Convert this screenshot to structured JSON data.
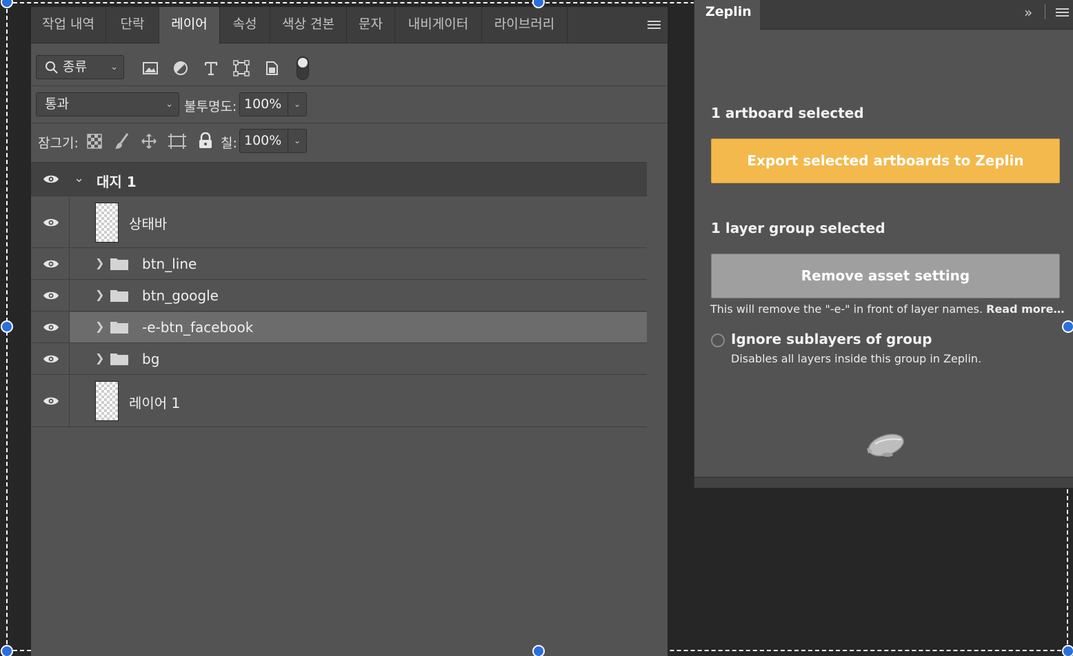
{
  "layers_panel": {
    "tabs": [
      {
        "label": "작업 내역"
      },
      {
        "label": "단락"
      },
      {
        "label": "레이어"
      },
      {
        "label": "속성"
      },
      {
        "label": "색상 견본"
      },
      {
        "label": "문자"
      },
      {
        "label": "내비게이터"
      },
      {
        "label": "라이브러리"
      }
    ],
    "active_tab": "레이어",
    "filter": {
      "kind_label": "종류"
    },
    "blend_mode": "통과",
    "opacity_label": "불투명도:",
    "opacity_value": "100%",
    "lock_label": "잠그기:",
    "fill_label": "칠:",
    "fill_value": "100%",
    "layers": [
      {
        "name": "대지 1",
        "type": "artboard",
        "expanded": true
      },
      {
        "name": "상태바",
        "type": "layer"
      },
      {
        "name": "btn_line",
        "type": "group",
        "expanded": false
      },
      {
        "name": "btn_google",
        "type": "group",
        "expanded": false
      },
      {
        "name": "-e-btn_facebook",
        "type": "group",
        "expanded": false,
        "selected": true
      },
      {
        "name": "bg",
        "type": "group",
        "expanded": false
      },
      {
        "name": "레이어 1",
        "type": "layer"
      }
    ]
  },
  "zeplin_panel": {
    "tab_label": "Zeplin",
    "artboard_heading": "1 artboard selected",
    "export_button": "Export selected artboards to Zeplin",
    "group_heading": "1 layer group selected",
    "remove_button": "Remove asset setting",
    "hint_text": "This will remove the \"-e-\" in front of layer names.",
    "hint_link": "Read more…",
    "ignore_label": "Ignore sublayers of group",
    "ignore_desc": "Disables all layers inside this group in Zeplin.",
    "colors": {
      "export": "#f3b94d",
      "remove": "#9f9f9f"
    }
  }
}
